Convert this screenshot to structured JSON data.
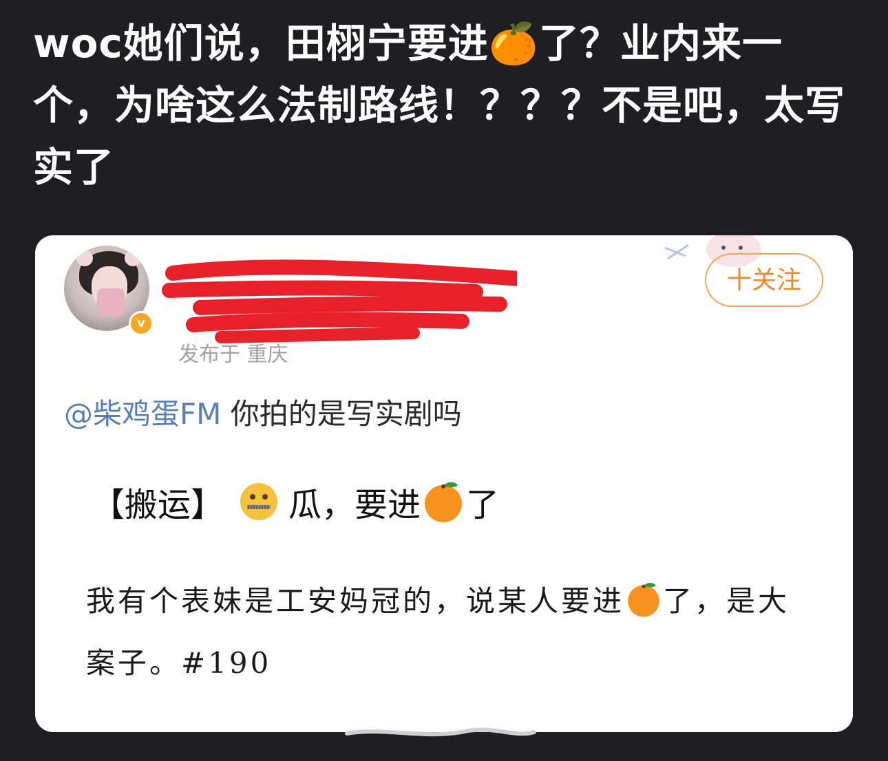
{
  "post": {
    "text": "woc她们说，田栩宁要进🍊了？业内来一个，为啥这么法制路线！？？？不是吧，太写实了"
  },
  "card": {
    "follow_label": "十关注",
    "location": "发布于 重庆",
    "mention_handle": "@柴鸡蛋FM",
    "mention_text": " 你拍的是写实剧吗",
    "tag_text": "【搬运】",
    "tag_after_emoji": "瓜，要进",
    "tag_end": "了",
    "line1_text": "我有个表妹是工安妈冠的，说某人要进",
    "line1_end": "了，是大",
    "line2_text": "案子。#190"
  },
  "icons": [
    "orange-emoji",
    "zipper-mouth-emoji",
    "verified-badge-icon",
    "avatar"
  ],
  "colors": {
    "background": "#1f1f23",
    "follow_accent": "#f08a29",
    "mention": "#5a7fb8",
    "redaction": "#e8202a"
  }
}
